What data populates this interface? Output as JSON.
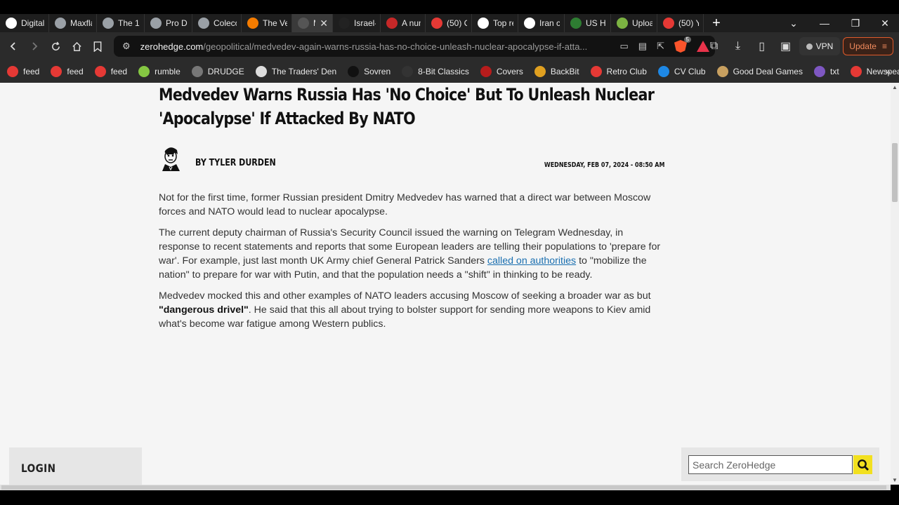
{
  "tabs": [
    {
      "label": "Digital",
      "color": "#ffffff",
      "icon": "page-icon"
    },
    {
      "label": "Maxfla",
      "color": "#9aa0a6",
      "icon": "globe-icon"
    },
    {
      "label": "The 18",
      "color": "#9aa0a6",
      "icon": "globe-icon"
    },
    {
      "label": "Pro De",
      "color": "#9aa0a6",
      "icon": "globe-icon"
    },
    {
      "label": "Coleco",
      "color": "#9aa0a6",
      "icon": "globe-icon"
    },
    {
      "label": "The Ve",
      "color": "#f57c00",
      "icon": "blogger-icon"
    },
    {
      "label": "Me",
      "color": "#555555",
      "icon": "zerohedge-icon",
      "active": true
    },
    {
      "label": "Israel-I",
      "color": "#222222",
      "icon": "generic-icon"
    },
    {
      "label": "A num",
      "color": "#c62828",
      "icon": "figure-icon"
    },
    {
      "label": "(50) Ci",
      "color": "#e53935",
      "icon": "gab-icon"
    },
    {
      "label": "Top re",
      "color": "#ffffff",
      "icon": "person-icon"
    },
    {
      "label": "Iran co",
      "color": "#ffffff",
      "icon": "person-icon"
    },
    {
      "label": "US Ho",
      "color": "#2e7d32",
      "icon": "rt-icon"
    },
    {
      "label": "Uploa",
      "color": "#7cb342",
      "icon": "rumble-icon"
    },
    {
      "label": "(50) Yo",
      "color": "#e53935",
      "icon": "gab-icon"
    }
  ],
  "url": {
    "host": "zerohedge.com",
    "path": "/geopolitical/medvedev-again-warns-russia-has-no-choice-unleash-nuclear-apocalypse-if-atta..."
  },
  "toolbar": {
    "vpn_label": "VPN",
    "update_label": "Update",
    "brave_badge": "5"
  },
  "bookmarks": [
    {
      "label": "feed",
      "color": "#e53935",
      "icon": "youtube-icon"
    },
    {
      "label": "feed",
      "color": "#e53935",
      "icon": "gab-icon"
    },
    {
      "label": "feed",
      "color": "#e53935",
      "icon": "c-icon"
    },
    {
      "label": "rumble",
      "color": "#85c742",
      "icon": "rumble-icon"
    },
    {
      "label": "DRUDGE",
      "color": "#777777",
      "icon": "drudge-icon"
    },
    {
      "label": "The Traders' Den",
      "color": "#dddddd",
      "icon": "traders-den-icon"
    },
    {
      "label": "Sovren",
      "color": "#111111",
      "icon": "sovren-icon"
    },
    {
      "label": "8-Bit Classics",
      "color": "#333333",
      "icon": "joystick-icon"
    },
    {
      "label": "Covers",
      "color": "#b71c1c",
      "icon": "covers-icon"
    },
    {
      "label": "BackBit",
      "color": "#e0a020",
      "icon": "backbit-icon"
    },
    {
      "label": "Retro Club",
      "color": "#e53935",
      "icon": "retro-club-icon"
    },
    {
      "label": "CV Club",
      "color": "#1e88e5",
      "icon": "cv-club-icon"
    },
    {
      "label": "Good Deal Games",
      "color": "#c8a060",
      "icon": "good-deal-games-icon"
    },
    {
      "label": "txt",
      "color": "#7e57c2",
      "icon": "txt-icon"
    },
    {
      "label": "Newspeak",
      "color": "#e53935",
      "icon": "newspeak-icon"
    }
  ],
  "article": {
    "title": "Medvedev Warns Russia Has 'No Choice' But To Unleash Nuclear 'Apocalypse' If Attacked By NATO",
    "byline": "BY TYLER DURDEN",
    "date": "WEDNESDAY, FEB 07, 2024 - 08:50 AM",
    "p1": "Not for the first time, former Russian president Dmitry Medvedev has warned that a direct war between Moscow forces and NATO would lead to nuclear apocalypse.",
    "p2_before": "The current deputy chairman of Russia's Security Council issued the warning on Telegram Wednesday, in response to recent statements and reports that some European leaders are telling their populations to 'prepare for war'. For example, just last month UK Army chief General Patrick Sanders ",
    "p2_link": "called on authorities",
    "p2_after": " to \"mobilize the nation\" to prepare for war with Putin, and that the population needs a \"shift\" in thinking to be ready.",
    "p3_before": "Medvedev mocked this and other examples of NATO leaders accusing Moscow of seeking a broader war as but ",
    "p3_bold": "\"dangerous drivel\"",
    "p3_after": ". He said that this all about trying to bolster support for sending more weapons to Kiev amid what's become war fatigue among Western publics."
  },
  "sidebar": {
    "login_label": "LOGIN",
    "search_placeholder": "Search ZeroHedge"
  }
}
